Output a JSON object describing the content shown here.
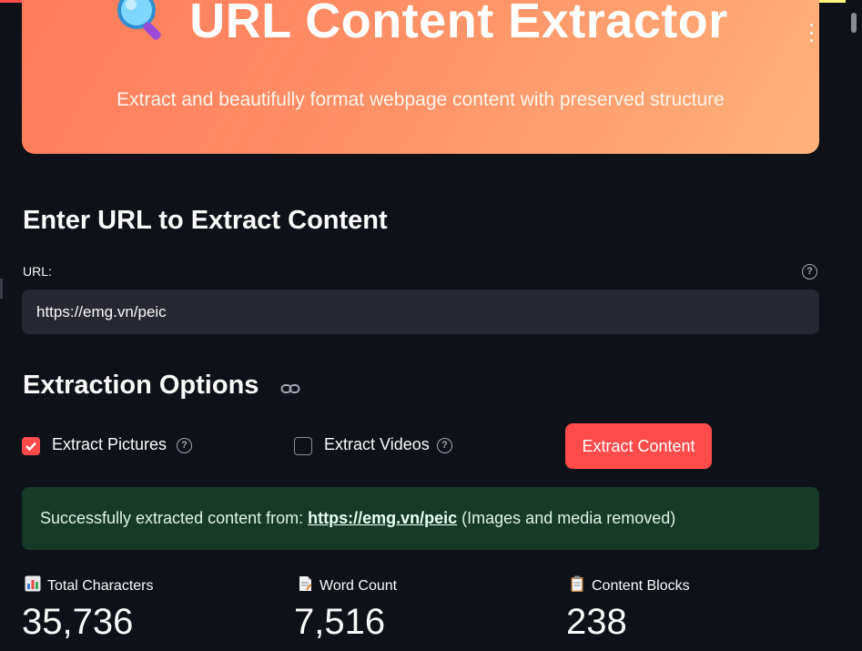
{
  "hero": {
    "title": "URL Content Extractor",
    "subtitle": "Extract and beautifully format webpage content with preserved structure",
    "icon": "magnifier-icon"
  },
  "url_section": {
    "heading": "Enter URL to Extract Content",
    "label": "URL:",
    "value": "https://emg.vn/peic"
  },
  "options": {
    "heading": "Extraction Options",
    "extract_pictures": {
      "label": "Extract Pictures",
      "checked": true
    },
    "extract_videos": {
      "label": "Extract Videos",
      "checked": false
    },
    "button_label": "Extract Content"
  },
  "status": {
    "prefix": "Successfully extracted content from:",
    "link": "https://emg.vn/peic",
    "suffix": "(Images and media removed)"
  },
  "metrics": [
    {
      "icon": "bar-chart-icon",
      "label": "Total Characters",
      "value": "35,736"
    },
    {
      "icon": "document-icon",
      "label": "Word Count",
      "value": "7,516"
    },
    {
      "icon": "clipboard-icon",
      "label": "Content Blocks",
      "value": "238"
    }
  ],
  "colors": {
    "accent": "#ff4b4b",
    "background": "#0e1117",
    "input_bg": "#262730",
    "success_bg": "#173928"
  }
}
